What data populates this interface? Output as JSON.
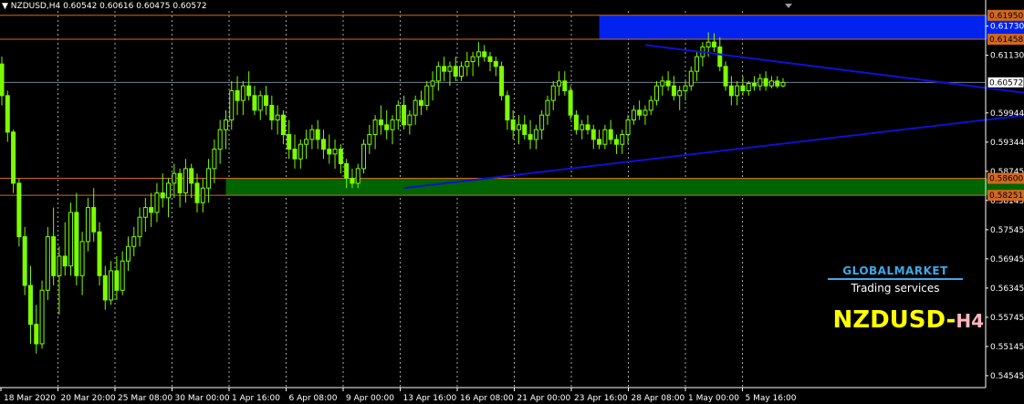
{
  "header": {
    "arrow": "▼",
    "symbol": "NZDUSD,H4",
    "ohlc": "0.60542 0.60616 0.60475 0.60572"
  },
  "watermark": {
    "logo_name": "GLOBALMARKET",
    "tagline": "Trading services",
    "symbol": "NZDUSD-",
    "timeframe": "H4"
  },
  "colors": {
    "background": "#000000",
    "candle": "#7cfc00",
    "grid": "#c0c0c0",
    "axis_text": "#ffffff",
    "resistance_zone": "#0022ee",
    "support_zone": "#006400",
    "level_line": "#d2691e",
    "trendline": "#1010d0",
    "current_price_line": "#708090"
  },
  "chart_data": {
    "type": "candlestick",
    "ylim": [
      0.543,
      0.6204
    ],
    "y_ticks": [
      "0.61950",
      "0.61730",
      "0.61458",
      "0.61130",
      "0.60572",
      "0.59944",
      "0.59344",
      "0.58745",
      "0.58600",
      "0.58251",
      "0.58145",
      "0.57545",
      "0.56945",
      "0.56345",
      "0.55745",
      "0.55145",
      "0.54545"
    ],
    "price_labels": [
      {
        "value": "0.61950",
        "style": "level"
      },
      {
        "value": "0.61458",
        "style": "level"
      },
      {
        "value": "0.60572",
        "style": "current"
      },
      {
        "value": "0.58600",
        "style": "level"
      },
      {
        "value": "0.58251",
        "style": "level"
      }
    ],
    "x_labels": [
      "18 Mar 2020",
      "20 Mar 20:00",
      "25 Mar 08:00",
      "30 Mar 00:00",
      "1 Apr 16:00",
      "6 Apr 08:00",
      "9 Apr 00:00",
      "13 Apr 16:00",
      "16 Apr 08:00",
      "21 Apr 00:00",
      "23 Apr 16:00",
      "28 Apr 08:00",
      "1 May 00:00",
      "5 May 16:00"
    ],
    "zones": [
      {
        "name": "resistance",
        "from_bar": 104,
        "to_bar": 264,
        "top": 0.6195,
        "bottom": 0.61458
      },
      {
        "name": "support",
        "from_bar": 39,
        "to_bar": 235,
        "top": 0.586,
        "bottom": 0.58251
      }
    ],
    "trendlines": [
      {
        "name": "upper",
        "from": {
          "bar": 112,
          "price": 0.6134
        },
        "to": {
          "bar": 190,
          "price": 0.6018
        }
      },
      {
        "name": "lower",
        "from": {
          "bar": 70,
          "price": 0.584
        },
        "to": {
          "bar": 190,
          "price": 0.6006
        }
      }
    ],
    "current_price": 0.60572,
    "candles": [
      [
        0.6095,
        0.611,
        0.601,
        0.603
      ],
      [
        0.603,
        0.604,
        0.5935,
        0.5955
      ],
      [
        0.5955,
        0.596,
        0.583,
        0.585
      ],
      [
        0.585,
        0.586,
        0.572,
        0.574
      ],
      [
        0.574,
        0.576,
        0.562,
        0.564
      ],
      [
        0.564,
        0.568,
        0.552,
        0.556
      ],
      [
        0.556,
        0.56,
        0.55,
        0.552
      ],
      [
        0.552,
        0.565,
        0.551,
        0.563
      ],
      [
        0.563,
        0.576,
        0.561,
        0.574
      ],
      [
        0.574,
        0.58,
        0.564,
        0.566
      ],
      [
        0.566,
        0.572,
        0.558,
        0.57
      ],
      [
        0.57,
        0.577,
        0.566,
        0.568
      ],
      [
        0.568,
        0.581,
        0.566,
        0.579
      ],
      [
        0.579,
        0.583,
        0.564,
        0.566
      ],
      [
        0.566,
        0.575,
        0.562,
        0.573
      ],
      [
        0.573,
        0.582,
        0.571,
        0.58
      ],
      [
        0.58,
        0.584,
        0.573,
        0.575
      ],
      [
        0.575,
        0.577,
        0.564,
        0.566
      ],
      [
        0.566,
        0.568,
        0.559,
        0.561
      ],
      [
        0.561,
        0.569,
        0.56,
        0.567
      ],
      [
        0.567,
        0.57,
        0.561,
        0.563
      ],
      [
        0.563,
        0.571,
        0.562,
        0.569
      ],
      [
        0.569,
        0.574,
        0.567,
        0.572
      ],
      [
        0.572,
        0.576,
        0.57,
        0.574
      ],
      [
        0.574,
        0.58,
        0.572,
        0.578
      ],
      [
        0.578,
        0.582,
        0.575,
        0.58
      ],
      [
        0.58,
        0.583,
        0.576,
        0.579
      ],
      [
        0.579,
        0.585,
        0.577,
        0.583
      ],
      [
        0.583,
        0.587,
        0.58,
        0.582
      ],
      [
        0.582,
        0.586,
        0.578,
        0.585
      ],
      [
        0.585,
        0.589,
        0.582,
        0.587
      ],
      [
        0.587,
        0.588,
        0.58,
        0.583
      ],
      [
        0.583,
        0.59,
        0.581,
        0.588
      ],
      [
        0.588,
        0.589,
        0.582,
        0.585
      ],
      [
        0.585,
        0.587,
        0.579,
        0.581
      ],
      [
        0.581,
        0.586,
        0.579,
        0.584
      ],
      [
        0.584,
        0.59,
        0.581,
        0.588
      ],
      [
        0.588,
        0.594,
        0.585,
        0.592
      ],
      [
        0.592,
        0.598,
        0.589,
        0.596
      ],
      [
        0.596,
        0.6,
        0.592,
        0.598
      ],
      [
        0.598,
        0.606,
        0.596,
        0.604
      ],
      [
        0.604,
        0.607,
        0.599,
        0.602
      ],
      [
        0.602,
        0.606,
        0.599,
        0.605
      ],
      [
        0.605,
        0.608,
        0.602,
        0.603
      ],
      [
        0.603,
        0.605,
        0.599,
        0.6
      ],
      [
        0.6,
        0.604,
        0.598,
        0.603
      ],
      [
        0.603,
        0.605,
        0.599,
        0.601
      ],
      [
        0.601,
        0.603,
        0.596,
        0.598
      ],
      [
        0.598,
        0.601,
        0.595,
        0.599
      ],
      [
        0.599,
        0.6,
        0.593,
        0.595
      ],
      [
        0.595,
        0.598,
        0.59,
        0.592
      ],
      [
        0.592,
        0.595,
        0.588,
        0.59
      ],
      [
        0.59,
        0.594,
        0.588,
        0.593
      ],
      [
        0.593,
        0.596,
        0.59,
        0.594
      ],
      [
        0.594,
        0.597,
        0.592,
        0.596
      ],
      [
        0.596,
        0.598,
        0.592,
        0.594
      ],
      [
        0.594,
        0.596,
        0.59,
        0.592
      ],
      [
        0.592,
        0.595,
        0.589,
        0.591
      ],
      [
        0.591,
        0.594,
        0.588,
        0.592
      ],
      [
        0.592,
        0.593,
        0.587,
        0.589
      ],
      [
        0.589,
        0.59,
        0.584,
        0.586
      ],
      [
        0.586,
        0.588,
        0.584,
        0.585
      ],
      [
        0.585,
        0.589,
        0.584,
        0.588
      ],
      [
        0.588,
        0.594,
        0.587,
        0.593
      ],
      [
        0.593,
        0.597,
        0.591,
        0.595
      ],
      [
        0.595,
        0.599,
        0.592,
        0.598
      ],
      [
        0.598,
        0.601,
        0.595,
        0.597
      ],
      [
        0.597,
        0.6,
        0.594,
        0.596
      ],
      [
        0.596,
        0.599,
        0.593,
        0.598
      ],
      [
        0.598,
        0.602,
        0.596,
        0.601
      ],
      [
        0.601,
        0.603,
        0.596,
        0.597
      ],
      [
        0.597,
        0.6,
        0.595,
        0.599
      ],
      [
        0.599,
        0.603,
        0.597,
        0.602
      ],
      [
        0.602,
        0.604,
        0.599,
        0.601
      ],
      [
        0.601,
        0.606,
        0.6,
        0.605
      ],
      [
        0.605,
        0.608,
        0.602,
        0.606
      ],
      [
        0.606,
        0.61,
        0.604,
        0.609
      ],
      [
        0.609,
        0.611,
        0.606,
        0.608
      ],
      [
        0.608,
        0.61,
        0.605,
        0.609
      ],
      [
        0.609,
        0.611,
        0.606,
        0.607
      ],
      [
        0.607,
        0.61,
        0.606,
        0.609
      ],
      [
        0.609,
        0.612,
        0.607,
        0.61
      ],
      [
        0.61,
        0.612,
        0.607,
        0.611
      ],
      [
        0.611,
        0.614,
        0.609,
        0.612
      ],
      [
        0.612,
        0.6134,
        0.61,
        0.611
      ],
      [
        0.611,
        0.612,
        0.608,
        0.61
      ],
      [
        0.61,
        0.611,
        0.607,
        0.609
      ],
      [
        0.609,
        0.61,
        0.602,
        0.603
      ],
      [
        0.603,
        0.604,
        0.596,
        0.598
      ],
      [
        0.598,
        0.6,
        0.594,
        0.596
      ],
      [
        0.596,
        0.599,
        0.593,
        0.597
      ],
      [
        0.597,
        0.599,
        0.594,
        0.595
      ],
      [
        0.595,
        0.598,
        0.592,
        0.594
      ],
      [
        0.594,
        0.597,
        0.592,
        0.596
      ],
      [
        0.596,
        0.6,
        0.594,
        0.599
      ],
      [
        0.599,
        0.603,
        0.597,
        0.602
      ],
      [
        0.602,
        0.606,
        0.6,
        0.605
      ],
      [
        0.605,
        0.608,
        0.603,
        0.606
      ],
      [
        0.606,
        0.608,
        0.603,
        0.604
      ],
      [
        0.604,
        0.605,
        0.598,
        0.599
      ],
      [
        0.599,
        0.6,
        0.595,
        0.596
      ],
      [
        0.596,
        0.598,
        0.594,
        0.597
      ],
      [
        0.597,
        0.599,
        0.595,
        0.596
      ],
      [
        0.596,
        0.597,
        0.592,
        0.594
      ],
      [
        0.594,
        0.596,
        0.592,
        0.593
      ],
      [
        0.593,
        0.597,
        0.592,
        0.596
      ],
      [
        0.596,
        0.598,
        0.593,
        0.594
      ],
      [
        0.594,
        0.595,
        0.591,
        0.593
      ],
      [
        0.593,
        0.596,
        0.591,
        0.595
      ],
      [
        0.595,
        0.599,
        0.593,
        0.598
      ],
      [
        0.598,
        0.601,
        0.597,
        0.6
      ],
      [
        0.6,
        0.602,
        0.598,
        0.599
      ],
      [
        0.599,
        0.601,
        0.597,
        0.6
      ],
      [
        0.6,
        0.603,
        0.599,
        0.602
      ],
      [
        0.602,
        0.606,
        0.601,
        0.605
      ],
      [
        0.605,
        0.607,
        0.603,
        0.606
      ],
      [
        0.606,
        0.608,
        0.604,
        0.605
      ],
      [
        0.605,
        0.607,
        0.602,
        0.603
      ],
      [
        0.603,
        0.605,
        0.6,
        0.604
      ],
      [
        0.604,
        0.606,
        0.602,
        0.605
      ],
      [
        0.605,
        0.609,
        0.604,
        0.608
      ],
      [
        0.608,
        0.612,
        0.606,
        0.611
      ],
      [
        0.611,
        0.614,
        0.609,
        0.613
      ],
      [
        0.613,
        0.616,
        0.611,
        0.614
      ],
      [
        0.614,
        0.6158,
        0.612,
        0.613
      ],
      [
        0.613,
        0.615,
        0.608,
        0.609
      ],
      [
        0.609,
        0.61,
        0.604,
        0.605
      ],
      [
        0.605,
        0.607,
        0.601,
        0.603
      ],
      [
        0.603,
        0.606,
        0.601,
        0.605
      ],
      [
        0.605,
        0.607,
        0.603,
        0.604
      ],
      [
        0.604,
        0.606,
        0.603,
        0.6055
      ],
      [
        0.6055,
        0.607,
        0.604,
        0.605
      ],
      [
        0.605,
        0.6075,
        0.604,
        0.6065
      ],
      [
        0.6065,
        0.608,
        0.604,
        0.605
      ],
      [
        0.605,
        0.607,
        0.6045,
        0.606
      ],
      [
        0.606,
        0.607,
        0.6045,
        0.605
      ],
      [
        0.605,
        0.6066,
        0.6047,
        0.6057
      ]
    ]
  }
}
